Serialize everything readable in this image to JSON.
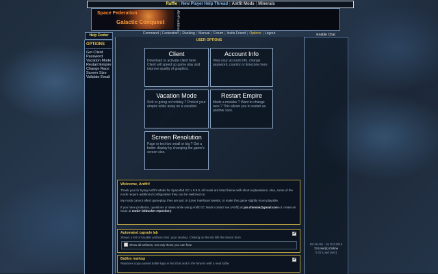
{
  "top_nav": {
    "items": [
      "Raffle",
      "New Player Help Thread",
      "Antfit Mods",
      "Minerals"
    ]
  },
  "banner": {
    "line1": "Space Federation",
    "line2": "Galactic Conquest",
    "side_text": "Alt+Frontières"
  },
  "help_center": "Help Center",
  "enable_chat": "Enable Chat",
  "main_nav": {
    "items": [
      "Command",
      "Federation",
      "Ranking",
      "Manual",
      "Forum",
      "Invite Friend",
      "Options",
      "Logout"
    ],
    "active": "Options"
  },
  "left_panel": {
    "title": "OPTIONS",
    "items": [
      "Get Client",
      "Password",
      "Vacation Mode",
      "Restart Empire",
      "Change Race",
      "Screen Size",
      "Validate Email"
    ]
  },
  "page_title": "USER OPTIONS",
  "options": [
    {
      "title": "Client",
      "desc": "Download or activate client here. Client will speed up game play and improve quality of graphics."
    },
    {
      "title": "Account Info",
      "desc": "View your account info, change password, country or timezone here."
    },
    {
      "title": "Vacation Mode",
      "desc": "Sick or going on holiday ? Protect your empire while away on a vacation."
    },
    {
      "title": "Restart Empire",
      "desc": "Made a mistake ? Want to change race ? This allows you to restart as another race."
    },
    {
      "title": "Screen Resolution",
      "desc": "Page or text too small or big ? Get a better display by changing the game's screen size."
    }
  ],
  "welcome": {
    "heading": "Welcome, Antfit!",
    "p1": "Thank you for trying Antfit's Mods for Spacefed GC v 0.9.0. All mods are listed below with short explanations. Also, some of the mods require additional configuration they can be switched on.",
    "p2": "My mods cannot affect gameplay, they are just UI (User Interface) tweaks, to make this game slightly more playable.",
    "p3_prefix": "If you have problems, questions or ideas while using Antfit GC Mods contact me (Antfit) at",
    "p3_email": "jan.chimiak@gmail.com",
    "p3_mid": "or create an issue at",
    "p3_link": "mods' bitbucket repository",
    "p3_end": "."
  },
  "mods": [
    {
      "name": "Automated capsule lab",
      "desc": "Shows a list of fusable artifacts (incl. your stocks). Clicking on the list fills the fusion form.",
      "checked": true,
      "sub_label": "Show all artifacts, not only those you can fuse",
      "sub_checked": false
    },
    {
      "name": "Battles markup",
      "desc": "Replaces copy-pasted battle logs in fed chat and in the forums with a neat table.",
      "checked": true
    }
  ],
  "right_panel": {
    "time": "09:18 AM - 19 Oct 2016",
    "online": "13 User(s) Online",
    "load": "0.02 Load (sec)"
  }
}
